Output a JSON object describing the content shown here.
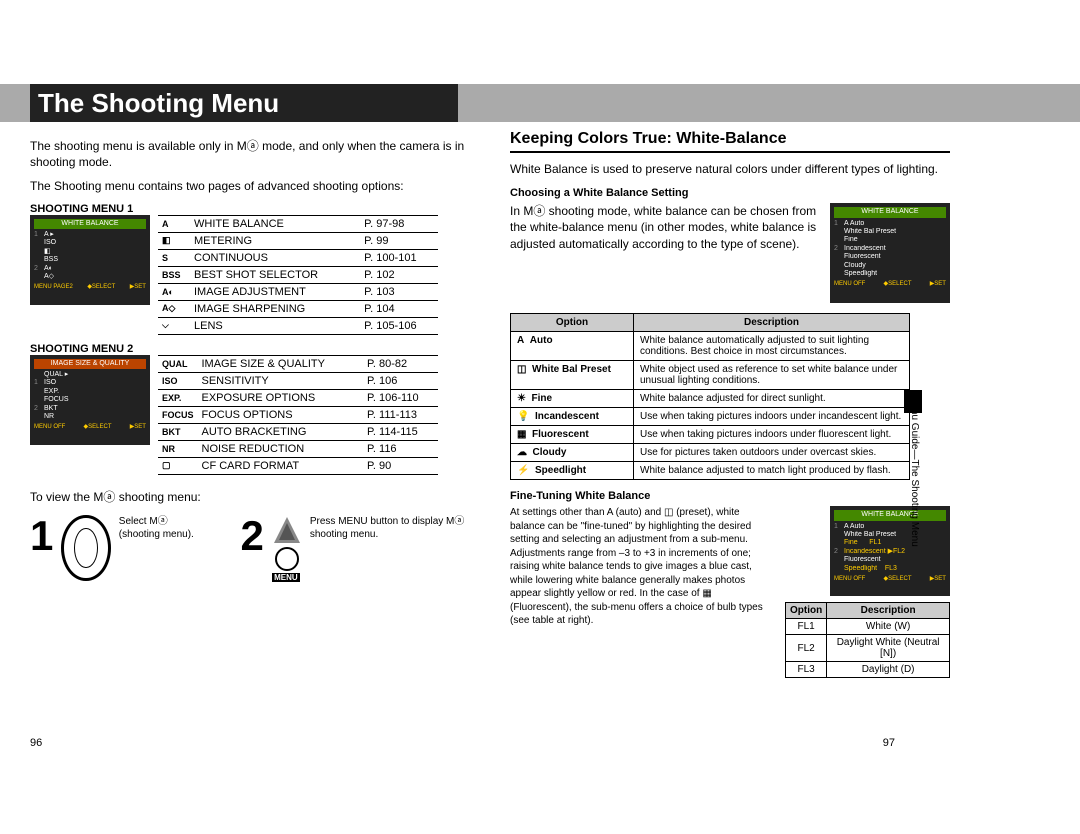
{
  "title": "The Shooting Menu",
  "intro1": "The shooting menu is available only in Mⓐ mode, and only when the camera is in shooting mode.",
  "intro2": "The Shooting menu contains two pages of advanced shooting options:",
  "sm1_label": "SHOOTING MENU 1",
  "sm2_label": "SHOOTING MENU 2",
  "view_label": "To view the Mⓐ shooting menu:",
  "lcd1_title": "WHITE BALANCE",
  "lcd2_title": "IMAGE SIZE & QUALITY",
  "sm1": [
    {
      "ico": "A",
      "name": "WHITE BALANCE",
      "page": "P. 97-98"
    },
    {
      "ico": "◧",
      "name": "METERING",
      "page": "P. 99"
    },
    {
      "ico": "S",
      "name": "CONTINUOUS",
      "page": "P. 100-101"
    },
    {
      "ico": "BSS",
      "name": "BEST SHOT SELECTOR",
      "page": "P. 102"
    },
    {
      "ico": "A◐",
      "name": "IMAGE ADJUSTMENT",
      "page": "P. 103"
    },
    {
      "ico": "A◇",
      "name": "IMAGE SHARPENING",
      "page": "P. 104"
    },
    {
      "ico": "⌵",
      "name": "LENS",
      "page": "P. 105-106"
    }
  ],
  "sm2": [
    {
      "ico": "QUAL",
      "name": "IMAGE SIZE & QUALITY",
      "page": "P. 80-82"
    },
    {
      "ico": "ISO",
      "name": "SENSITIVITY",
      "page": "P. 106"
    },
    {
      "ico": "EXP.",
      "name": "EXPOSURE OPTIONS",
      "page": "P. 106-110"
    },
    {
      "ico": "FOCUS",
      "name": "FOCUS OPTIONS",
      "page": "P. 111-113"
    },
    {
      "ico": "BKT",
      "name": "AUTO BRACKETING",
      "page": "P. 114-115"
    },
    {
      "ico": "NR",
      "name": "NOISE REDUCTION",
      "page": "P. 116"
    },
    {
      "ico": "▢",
      "name": "CF CARD FORMAT",
      "page": "P. 90"
    }
  ],
  "step1_num": "1",
  "step1_text": "Select Mⓐ (shooting menu).",
  "step2_num": "2",
  "step2_text": "Press MENU button to display Mⓐ shooting menu.",
  "menu_btn": "MENU",
  "page_left": "96",
  "page_right": "97",
  "h2": "Keeping Colors True: White-Balance",
  "wb_intro": "White Balance is used to preserve natural colors under different types of lighting.",
  "h3a": "Choosing a White Balance Setting",
  "wb_choose": "In Mⓐ shooting mode, white balance can be chosen from the white-balance menu (in other modes, white balance is adjusted automatically according to the type of scene).",
  "th_option": "Option",
  "th_desc": "Description",
  "wb_options": [
    {
      "ico": "A",
      "name": "Auto",
      "desc": "White balance automatically adjusted to suit lighting conditions. Best choice in most circumstances."
    },
    {
      "ico": "◫",
      "name": "White Bal Preset",
      "desc": "White object used as reference to set white balance under unusual lighting conditions."
    },
    {
      "ico": "☀",
      "name": "Fine",
      "desc": "White balance adjusted for direct sunlight."
    },
    {
      "ico": "💡",
      "name": "Incandescent",
      "desc": "Use when taking pictures indoors under incandescent light."
    },
    {
      "ico": "▦",
      "name": "Fluorescent",
      "desc": "Use when taking pictures indoors under fluorescent light."
    },
    {
      "ico": "☁",
      "name": "Cloudy",
      "desc": "Use for pictures taken outdoors under overcast skies."
    },
    {
      "ico": "⚡",
      "name": "Speedlight",
      "desc": "White balance adjusted to match light produced by flash."
    }
  ],
  "h3b": "Fine-Tuning White Balance",
  "fine_text": "At settings other than A (auto) and ◫ (preset), white balance can be \"fine-tuned\" by highlighting the desired setting and selecting an adjustment from a sub-menu. Adjustments range from –3 to +3 in increments of one; raising white balance tends to give images a blue cast, while lowering white balance generally makes photos appear slightly yellow or red. In the case of ▦ (Fluorescent), the sub-menu offers a choice of bulb types (see table at right).",
  "fl_options": [
    {
      "opt": "FL1",
      "desc": "White (W)"
    },
    {
      "opt": "FL2",
      "desc": "Daylight White (Neutral [N])"
    },
    {
      "opt": "FL3",
      "desc": "Daylight (D)"
    }
  ],
  "lcd_wb_title": "WHITE BALANCE",
  "lcd_wb_items": [
    "A Auto",
    "White Bal Preset",
    "Fine",
    "Incandescent",
    "Fluorescent",
    "Cloudy",
    "Speedlight"
  ],
  "lcd_foot_l": "MENU OFF",
  "lcd_foot_m": "◆SELECT",
  "lcd_foot_r": "▶SET",
  "side_tab": "Menu Guide—The Shooting Menu"
}
